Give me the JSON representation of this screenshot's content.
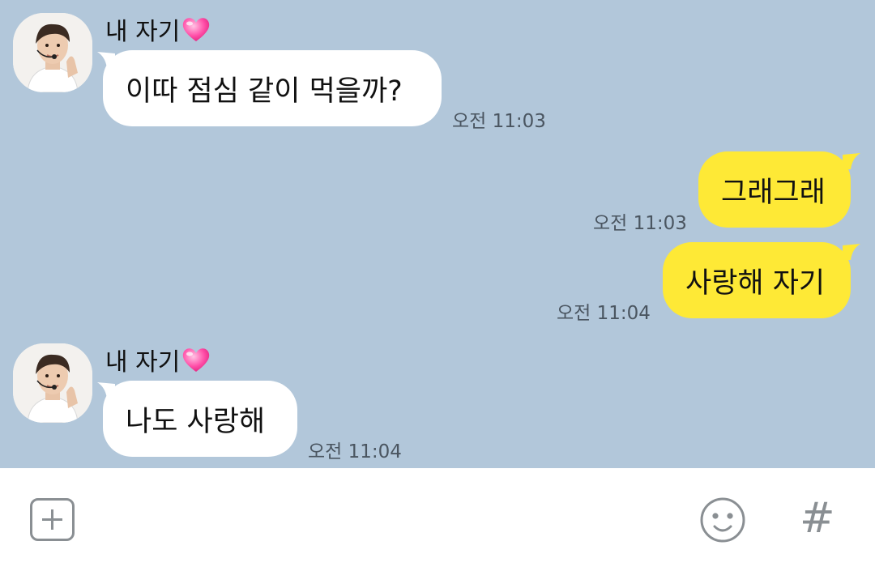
{
  "chat": {
    "messages": [
      {
        "direction": "in",
        "sender": "내 자기",
        "text": "이따 점심 같이 먹을까?",
        "time": "오전 11:03"
      },
      {
        "direction": "out",
        "text": "그래그래",
        "time": "오전 11:03"
      },
      {
        "direction": "out",
        "text": "사랑해 자기",
        "time": "오전 11:04"
      },
      {
        "direction": "in",
        "sender": "내 자기",
        "text": "나도 사랑해",
        "time": "오전 11:04"
      }
    ]
  },
  "input_bar": {
    "plus_icon": "plus-square-icon",
    "emoji_icon": "smiley-face-icon",
    "hash_icon": "hash-icon",
    "hash_glyph": "#"
  },
  "colors": {
    "background": "#b2c7da",
    "incoming_bubble": "#ffffff",
    "outgoing_bubble": "#fee936",
    "icon_gray": "#8a8f93"
  }
}
